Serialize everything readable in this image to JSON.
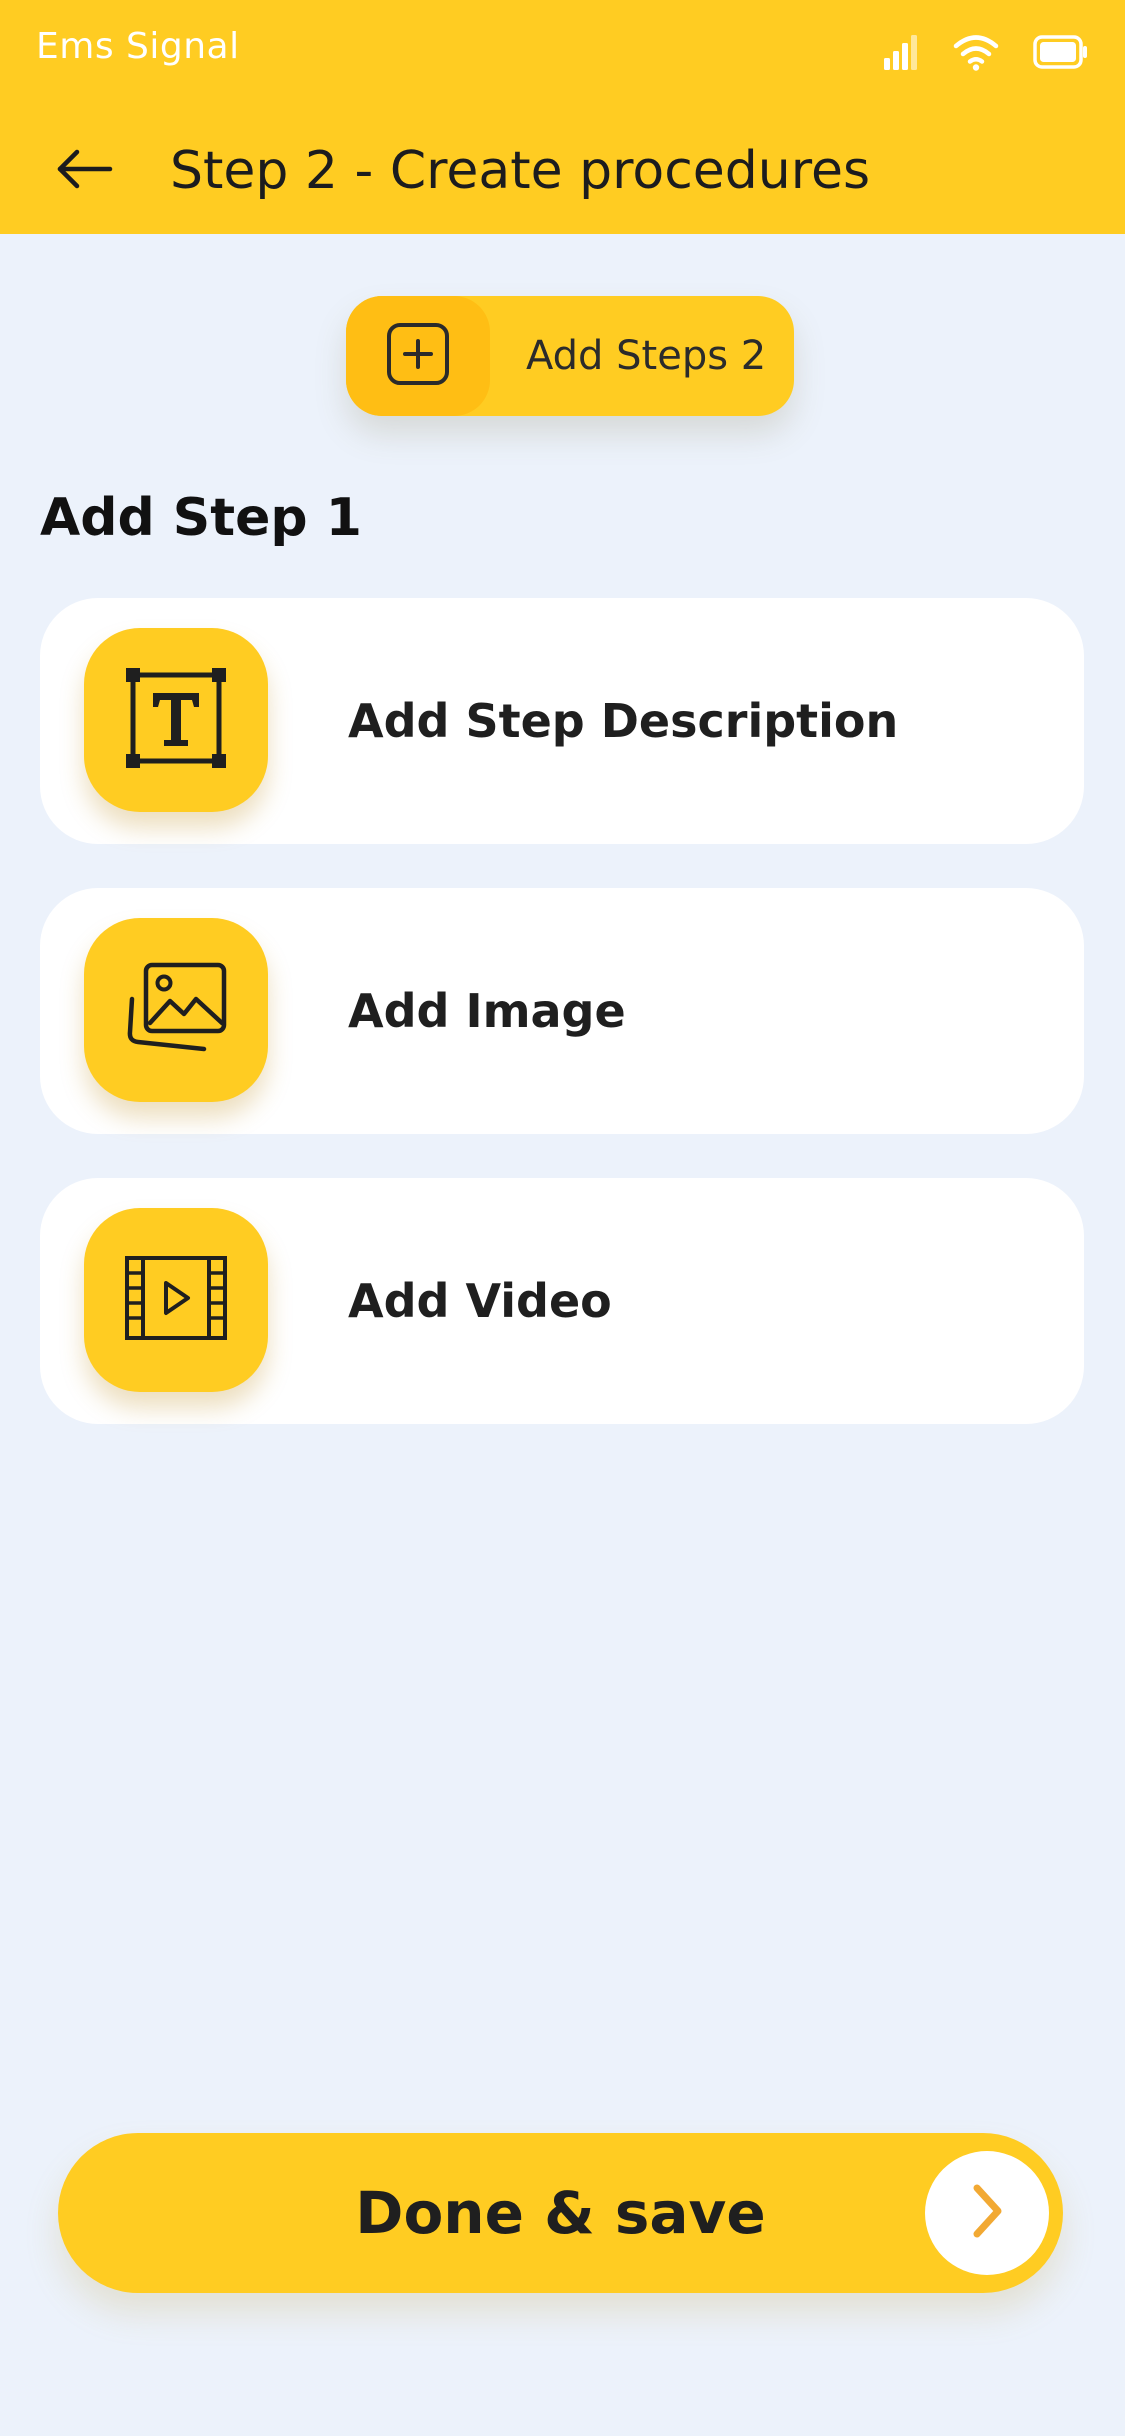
{
  "status_bar": {
    "carrier": "Ems Signal",
    "icons": [
      "signal-icon",
      "wifi-icon",
      "battery-icon"
    ]
  },
  "header": {
    "title": "Step 2 - Create procedures",
    "back_icon": "arrow-left-icon"
  },
  "add_steps": {
    "label": "Add Steps 2",
    "icon": "plus-square-icon"
  },
  "section": {
    "heading": "Add Step 1"
  },
  "options": [
    {
      "label": "Add Step Description",
      "icon": "text-frame-icon"
    },
    {
      "label": "Add Image",
      "icon": "image-icon"
    },
    {
      "label": "Add Video",
      "icon": "video-icon"
    }
  ],
  "footer": {
    "done_label": "Done & save",
    "arrow_icon": "chevron-right-icon"
  },
  "colors": {
    "primary": "#FFCC22",
    "primary_dark": "#FFBE14",
    "background": "#ECF2FB",
    "card": "#FFFFFF",
    "text": "#1F1F1F",
    "accent_arrow": "#F2A933"
  }
}
